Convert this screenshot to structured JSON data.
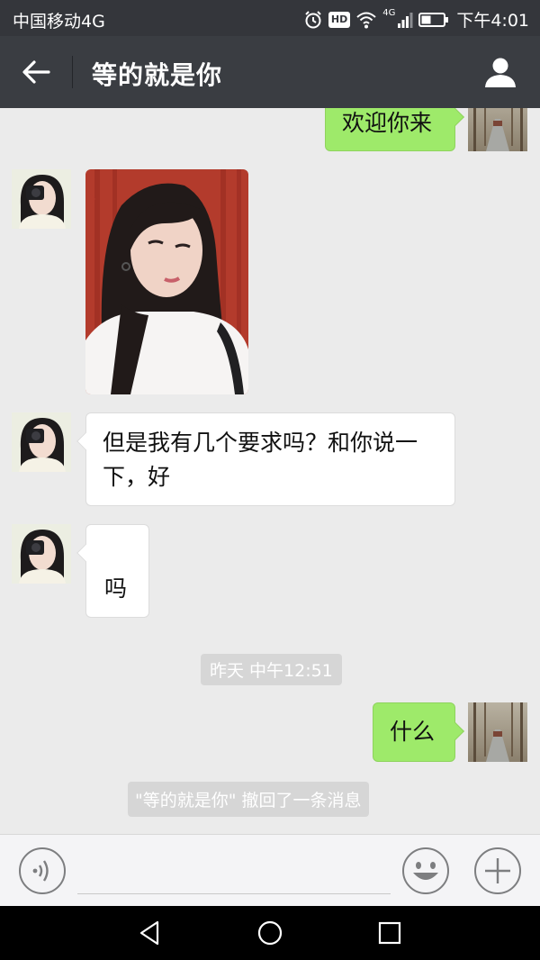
{
  "status_bar": {
    "carrier": "中国移动4G",
    "hd_badge": "HD",
    "network": "4G",
    "time": "下午4:01"
  },
  "header": {
    "title": "等的就是你"
  },
  "messages": [
    {
      "side": "out",
      "text": "欢迎你来"
    },
    {
      "side": "in",
      "type": "image"
    },
    {
      "side": "in",
      "text": "但是我有几个要求吗？和你说一下，好"
    },
    {
      "side": "in",
      "text": "吗"
    },
    {
      "side": "system",
      "text": "昨天 中午12:51"
    },
    {
      "side": "out",
      "text": "什么"
    },
    {
      "side": "system",
      "text": "\"等的就是你\" 撤回了一条消息"
    }
  ],
  "lines": {
    "m3_line1": "但是我有几个要求吗？和你说一",
    "m3_line2": "下，好"
  },
  "input": {
    "placeholder": "",
    "value": ""
  },
  "colors": {
    "status_bar_bg": "#34363b",
    "nav_bg": "#3a3d42",
    "chat_bg": "#ebebeb",
    "outgoing_bubble": "#9eea6a",
    "incoming_bubble": "#ffffff"
  },
  "icons": [
    "alarm-icon",
    "wifi-icon",
    "signal-icon",
    "battery-icon",
    "back-arrow-icon",
    "profile-icon",
    "voice-icon",
    "emoji-icon",
    "plus-icon",
    "nav-back-icon",
    "nav-home-icon",
    "nav-recents-icon"
  ]
}
